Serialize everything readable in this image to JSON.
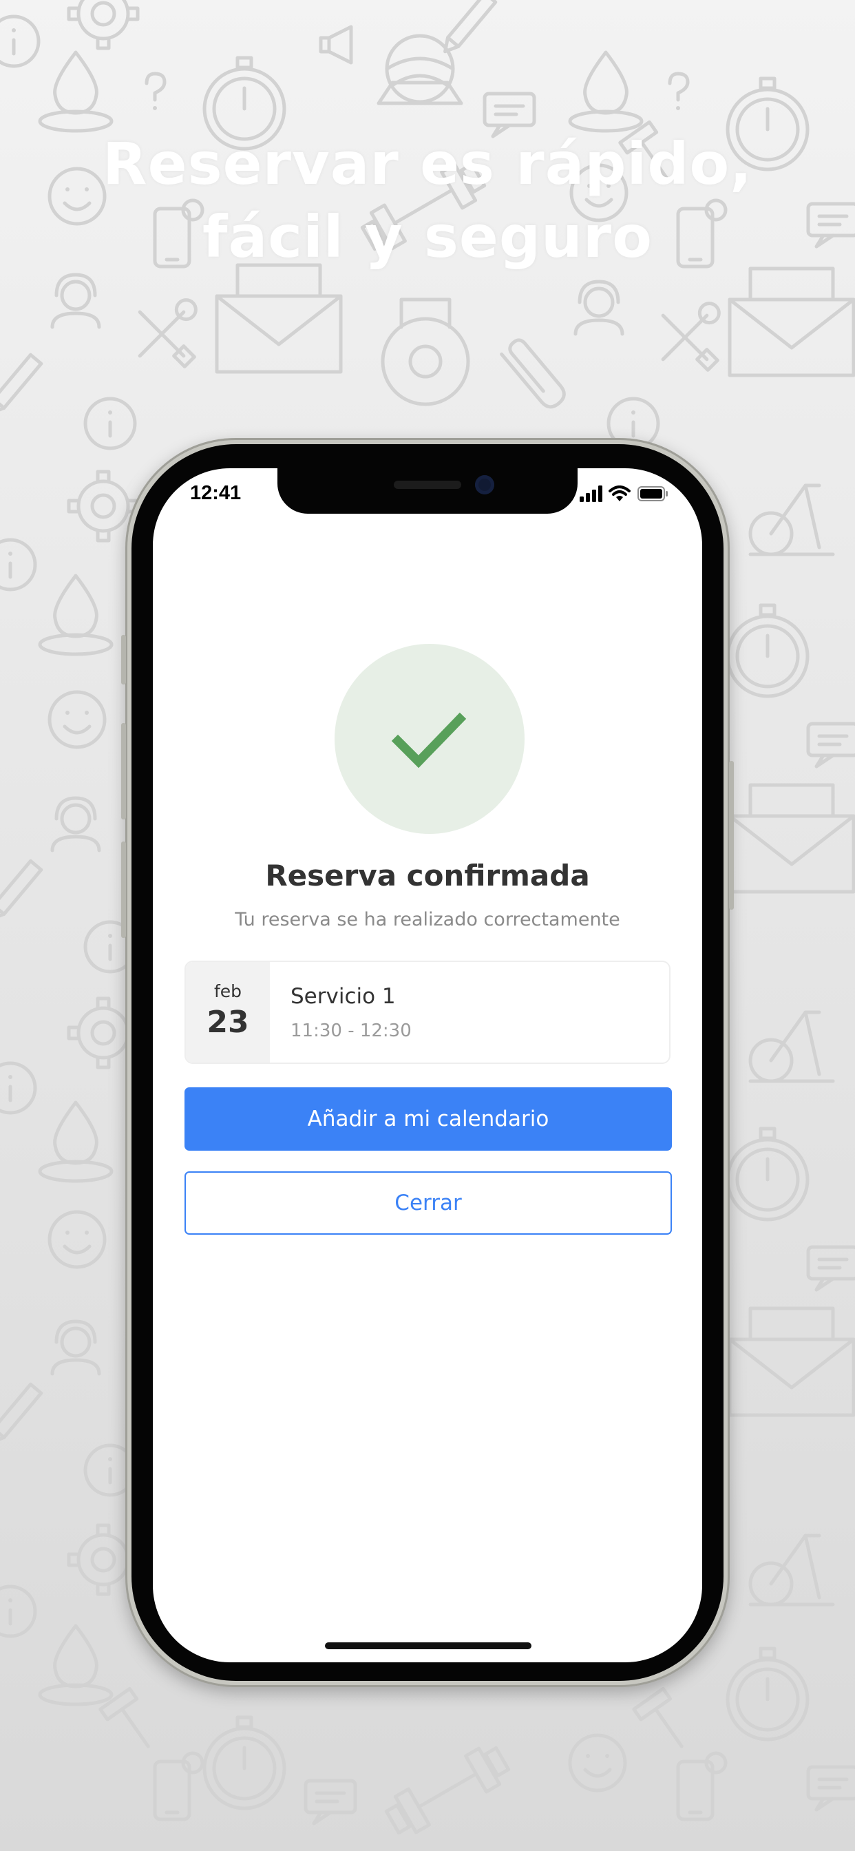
{
  "headline": {
    "line1": "Reservar es rápido,",
    "line2": "fácil y seguro"
  },
  "status_bar": {
    "time": "12:41",
    "icons": [
      "cellular-signal-icon",
      "wifi-icon",
      "battery-icon"
    ]
  },
  "confirmation": {
    "icon": "checkmark-icon",
    "title": "Reserva confirmada",
    "subtitle": "Tu reserva se ha realizado correctamente"
  },
  "booking": {
    "month": "feb",
    "day": "23",
    "service": "Servicio 1",
    "time_range": "11:30 - 12:30"
  },
  "buttons": {
    "add_calendar": "Añadir a mi calendario",
    "close": "Cerrar"
  },
  "colors": {
    "accent": "#3b82f6",
    "success": "#58a05a",
    "success_bg": "#e7efe6",
    "text": "#333333",
    "muted": "#8a8a8a"
  },
  "background_pattern_icons": [
    "gear-icon",
    "stopwatch-icon",
    "envelope-icon",
    "kettlebell-icon",
    "dumbbell-icon",
    "smiley-icon",
    "info-icon",
    "question-icon",
    "wrench-icon",
    "paperclip-icon",
    "exercise-bike-icon",
    "phone-icon",
    "headset-icon",
    "chat-icon",
    "water-drop-icon",
    "hammer-icon",
    "pencil-icon",
    "megaphone-icon",
    "ball-icon"
  ]
}
